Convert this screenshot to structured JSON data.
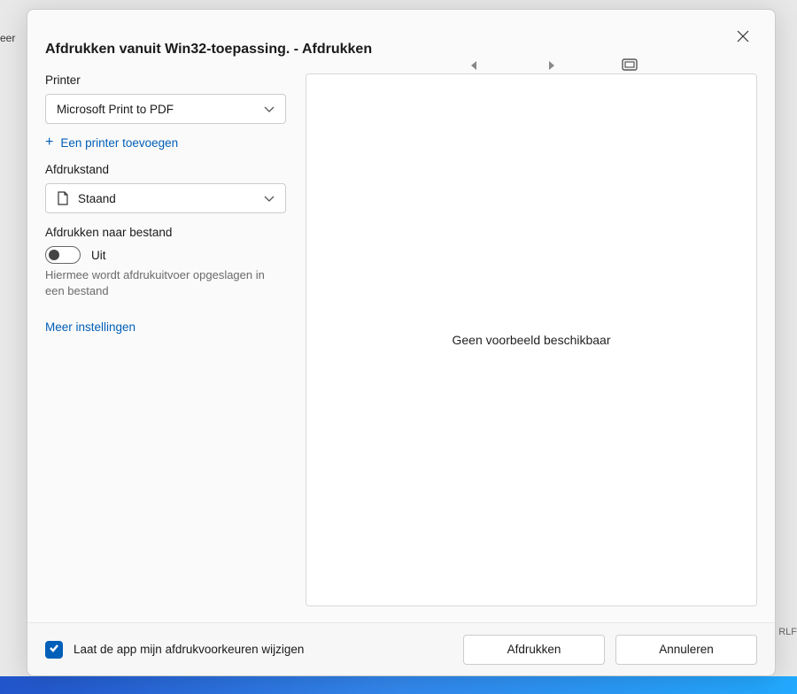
{
  "backdrop": {
    "left_text": "eer",
    "right_text": "RLF"
  },
  "dialog": {
    "title": "Afdrukken vanuit Win32-toepassing. - Afdrukken"
  },
  "printer": {
    "label": "Printer",
    "selected": "Microsoft Print to PDF",
    "add_link": "Een printer toevoegen"
  },
  "orientation": {
    "label": "Afdrukstand",
    "selected": "Staand"
  },
  "print_to_file": {
    "label": "Afdrukken naar bestand",
    "state_label": "Uit",
    "helper": "Hiermee wordt afdrukuitvoer opgeslagen in een bestand"
  },
  "more_settings": "Meer instellingen",
  "preview": {
    "empty_text": "Geen voorbeeld beschikbaar"
  },
  "footer": {
    "checkbox_label": "Laat de app mijn afdrukvoorkeuren wijzigen",
    "print": "Afdrukken",
    "cancel": "Annuleren"
  }
}
